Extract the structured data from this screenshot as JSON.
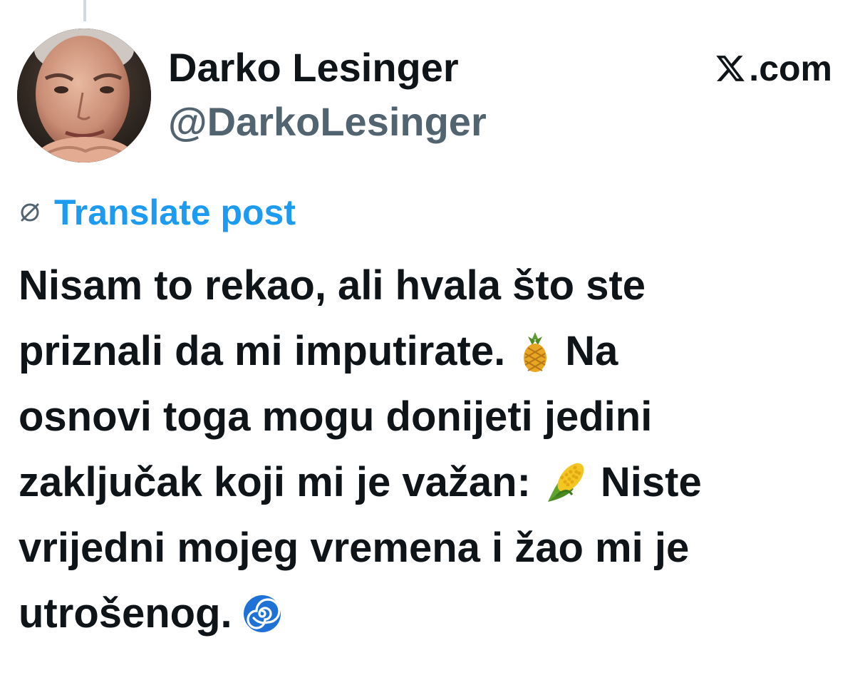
{
  "author": {
    "display_name": "Darko Lesinger",
    "handle": "@DarkoLesinger"
  },
  "brand": {
    "domain_suffix": ".com",
    "logo_icon": "x-logo-icon"
  },
  "translate": {
    "label": "Translate post",
    "icon": "globe-icon"
  },
  "post": {
    "lines": {
      "l1": "Nisam to rekao, ali hvala što ste",
      "l2a": "priznali da mi imputirate.",
      "l2b": "Na",
      "l3": "osnovi toga mogu donijeti jedini",
      "l4a": "zaključak koji mi je važan:",
      "l4b": "Niste",
      "l5": "vrijedni mojeg vremena i žao mi je",
      "l6a": "utrošenog."
    },
    "emojis": [
      "pineapple-emoji",
      "corn-emoji",
      "cyclone-emoji"
    ]
  },
  "colors": {
    "accent": "#1d9bf0",
    "text": "#0f1419",
    "secondary_text": "#536471"
  }
}
